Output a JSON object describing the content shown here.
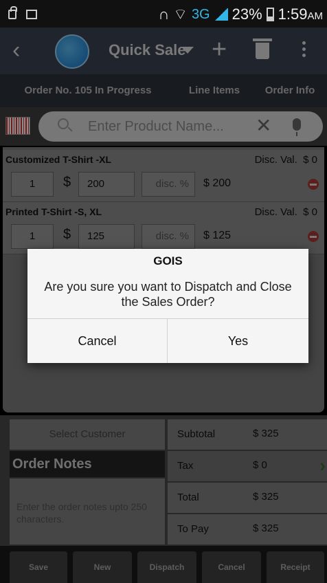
{
  "status_bar": {
    "network": "3G",
    "battery": "23%",
    "time": "1:59",
    "ampm": "AM"
  },
  "action_bar": {
    "title": "Quick Sale",
    "icons": [
      "back-icon",
      "app-logo",
      "dropdown-caret-icon",
      "add-icon",
      "trash-icon",
      "overflow-menu-icon"
    ]
  },
  "tabs": [
    {
      "label": "Order No. 105 In Progress"
    },
    {
      "label": "Line Items"
    },
    {
      "label": "Order Info"
    }
  ],
  "search": {
    "placeholder": "Enter Product Name...",
    "clear_glyph": "✕"
  },
  "line_items": [
    {
      "name": "Customized T-Shirt -XL",
      "disc_label": "Disc. Val.",
      "disc_value": "$ 0",
      "qty": "1",
      "currency": "$",
      "price": "200",
      "disc_placeholder": "disc. %",
      "total": "$ 200"
    },
    {
      "name": "Printed T-Shirt -S, XL",
      "disc_label": "Disc. Val.",
      "disc_value": "$ 0",
      "qty": "1",
      "currency": "$",
      "price": "125",
      "disc_placeholder": "disc. %",
      "total": "$ 125"
    }
  ],
  "customer": {
    "select_label": "Select Customer"
  },
  "notes": {
    "title": "Order Notes",
    "placeholder": "Enter the order notes upto 250 characters."
  },
  "summary": [
    {
      "label": "Subtotal",
      "value": "$ 325"
    },
    {
      "label": "Tax",
      "value": "$ 0"
    },
    {
      "label": "Total",
      "value": "$ 325"
    },
    {
      "label": "To Pay",
      "value": "$ 325"
    }
  ],
  "bottom_buttons": [
    {
      "label": "Save"
    },
    {
      "label": "New"
    },
    {
      "label": "Dispatch"
    },
    {
      "label": "Cancel"
    },
    {
      "label": "Receipt"
    }
  ],
  "dialog": {
    "title": "GOIS",
    "message": "Are you sure you want to Dispatch and Close the Sales Order?",
    "cancel_label": "Cancel",
    "yes_label": "Yes"
  },
  "colors": {
    "action_bar": "#3b4350",
    "tab_bar": "#2c333d",
    "accent_blue": "#33b5e5",
    "remove_red": "#a83a35",
    "chevron_green": "#3a6b2a"
  }
}
